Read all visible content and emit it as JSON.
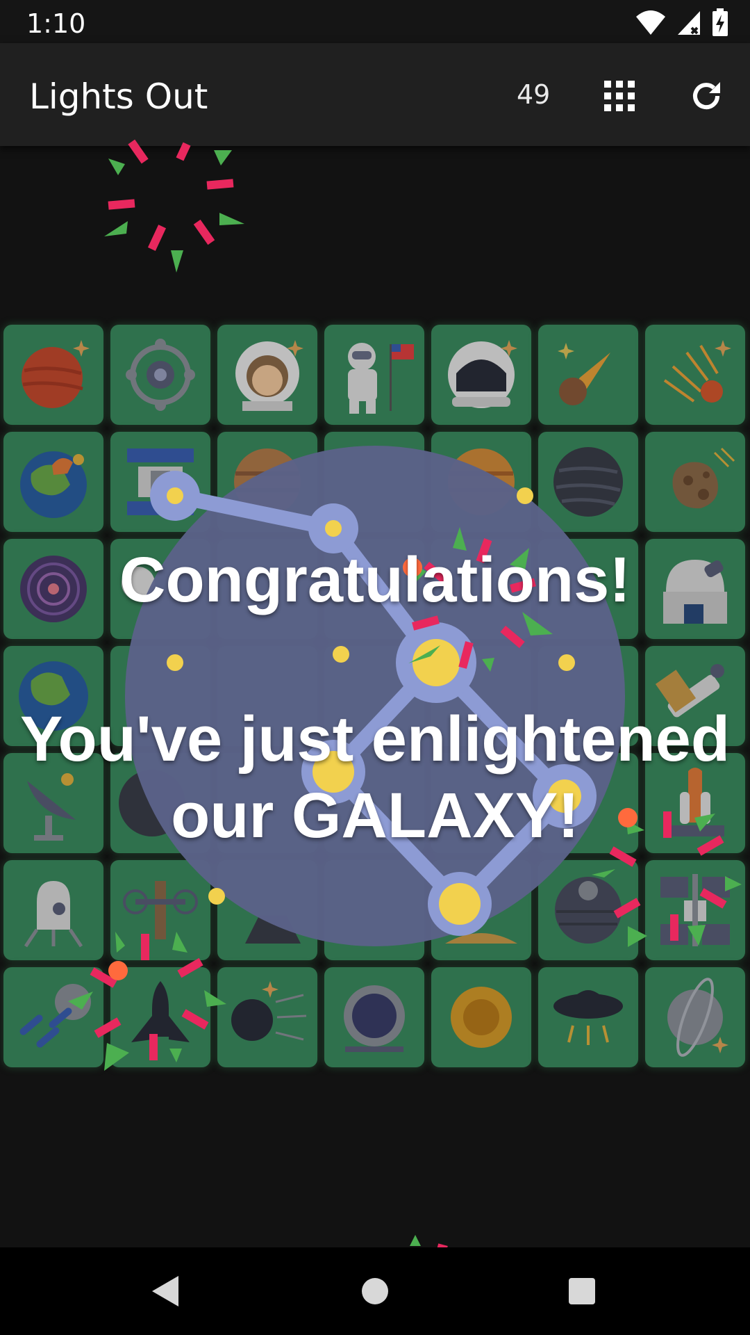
{
  "status_bar": {
    "time": "1:10",
    "icons": [
      "wifi-icon",
      "signal-icon",
      "battery-charging-icon"
    ]
  },
  "app_bar": {
    "title": "Lights Out",
    "count": "49",
    "icons": [
      "grid-icon",
      "refresh-icon"
    ]
  },
  "board": {
    "rows": 7,
    "cols": 7,
    "tiles": [
      [
        "red-planet",
        "space-station-module",
        "astronaut-face",
        "astronaut-flag",
        "space-helmet",
        "comet",
        "meteor-shower"
      ],
      [
        "earth-volcano",
        "solar-satellite",
        "jupiter",
        "unknown",
        "saturn-orange",
        "dark-planet",
        "asteroid"
      ],
      [
        "spiral-galaxy",
        "astronaut",
        "unknown",
        "unknown",
        "unknown",
        "unknown",
        "observatory"
      ],
      [
        "earth",
        "unknown",
        "unknown",
        "unknown",
        "unknown",
        "unknown",
        "telescope"
      ],
      [
        "satellite-dish",
        "moon",
        "unknown",
        "unknown",
        "unknown",
        "unknown",
        "space-shuttle-launch"
      ],
      [
        "lunar-lander",
        "drone-probe",
        "rocket",
        "unknown",
        "desert-planet",
        "death-star",
        "space-station"
      ],
      [
        "rocket-fleet",
        "space-shuttle",
        "black-hole-sun",
        "porthole",
        "sun",
        "ufo",
        "ringed-planet"
      ]
    ]
  },
  "dialog": {
    "line1": "Congratulations!",
    "line2": "You've just enlightened",
    "line3": "our GALAXY!"
  },
  "colors": {
    "tile": "#3a8a5e",
    "galaxy_circle": "#5b6288",
    "constellation": "#8d9bd4",
    "star": "#f2d14e",
    "confetti_pink": "#e8285e",
    "confetti_green": "#4caf50",
    "confetti_orange": "#ff6a3d"
  },
  "nav_bar": {
    "icons": [
      "back-icon",
      "home-icon",
      "recents-icon"
    ]
  }
}
